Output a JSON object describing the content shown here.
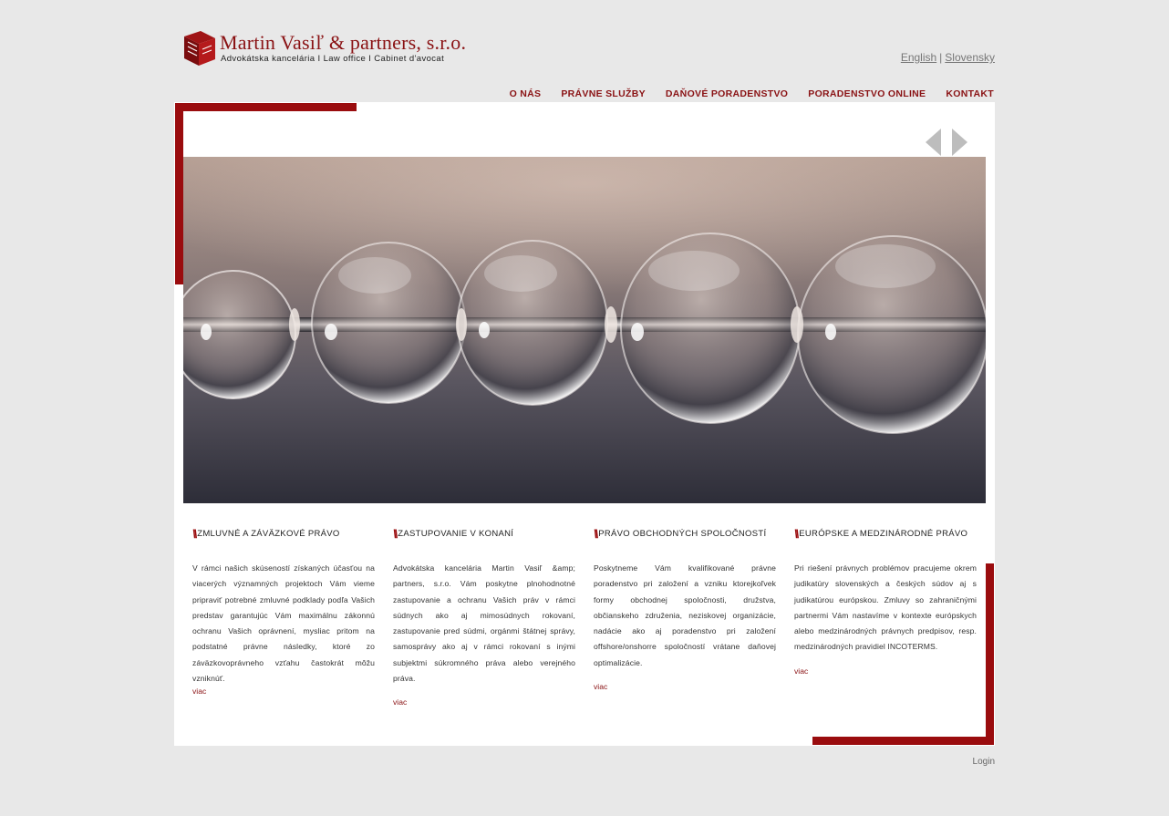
{
  "logo": {
    "name": "Martin Vasiľ & partners, s.r.o.",
    "tagline": "Advokátska kancelária  I  Law office  I  Cabinet d'avocat"
  },
  "language": {
    "english": "English",
    "separator": "|",
    "slovak": "Slovensky"
  },
  "nav": {
    "items": [
      {
        "label": "O NÁS"
      },
      {
        "label": "PRÁVNE SLUŽBY"
      },
      {
        "label": "DAŇOVÉ PORADENSTVO"
      },
      {
        "label": "PORADENSTVO ONLINE"
      },
      {
        "label": "KONTAKT"
      }
    ]
  },
  "slider": {
    "prev_icon": "arrow-left-icon",
    "next_icon": "arrow-right-icon"
  },
  "columns": [
    {
      "title": "ZMLUVNÉ A ZÁVÄZKOVÉ PRÁVO",
      "text": "V rámci našich skúseností získaných účasťou na viacerých významných projektoch Vám vieme pripraviť potrebné zmluvné podklady podľa Vašich predstav garantujúc Vám maximálnu zákonnú ochranu Vašich oprávnení, mysliac pritom na podstatné právne následky, ktoré zo záväzkovoprávneho vzťahu častokrát môžu vzniknúť.",
      "more": "viac"
    },
    {
      "title": "ZASTUPOVANIE V KONANÍ",
      "text": "Advokátska kancelária Martin Vasiľ &amp; partners, s.r.o. Vám poskytne plnohodnotné zastupovanie a ochranu Vašich práv v rámci súdnych ako aj mimosúdnych rokovaní, zastupovanie pred súdmi, orgánmi štátnej správy, samosprávy ako aj v rámci rokovaní s inými subjektmi súkromného práva alebo verejného práva.",
      "more": "viac"
    },
    {
      "title": "PRÁVO OBCHODNÝCH SPOLOČNOSTÍ",
      "text": "Poskytneme Vám kvalifikované právne poradenstvo pri založení a vzniku ktorejkoľvek formy obchodnej spoločnosti, družstva, občianskeho združenia, neziskovej organizácie, nadácie ako aj poradenstvo pri založení offshore/onshorre spoločností vrátane daňovej optimalizácie.",
      "more": "viac"
    },
    {
      "title": "EURÓPSKE A MEDZINÁRODNÉ PRÁVO",
      "text": "Pri riešení právnych problémov pracujeme okrem judikatúry slovenských a českých súdov aj s judikatúrou európskou. Zmluvy so zahraničnými partnermi Vám nastavíme v kontexte európskych alebo medzinárodných právnych predpisov, resp. medzinárodných pravidiel INCOTERMS.",
      "more": "viac"
    }
  ],
  "footer": {
    "login": "Login"
  },
  "colors": {
    "brand": "#9a0c0e",
    "background": "#e8e8e8"
  }
}
